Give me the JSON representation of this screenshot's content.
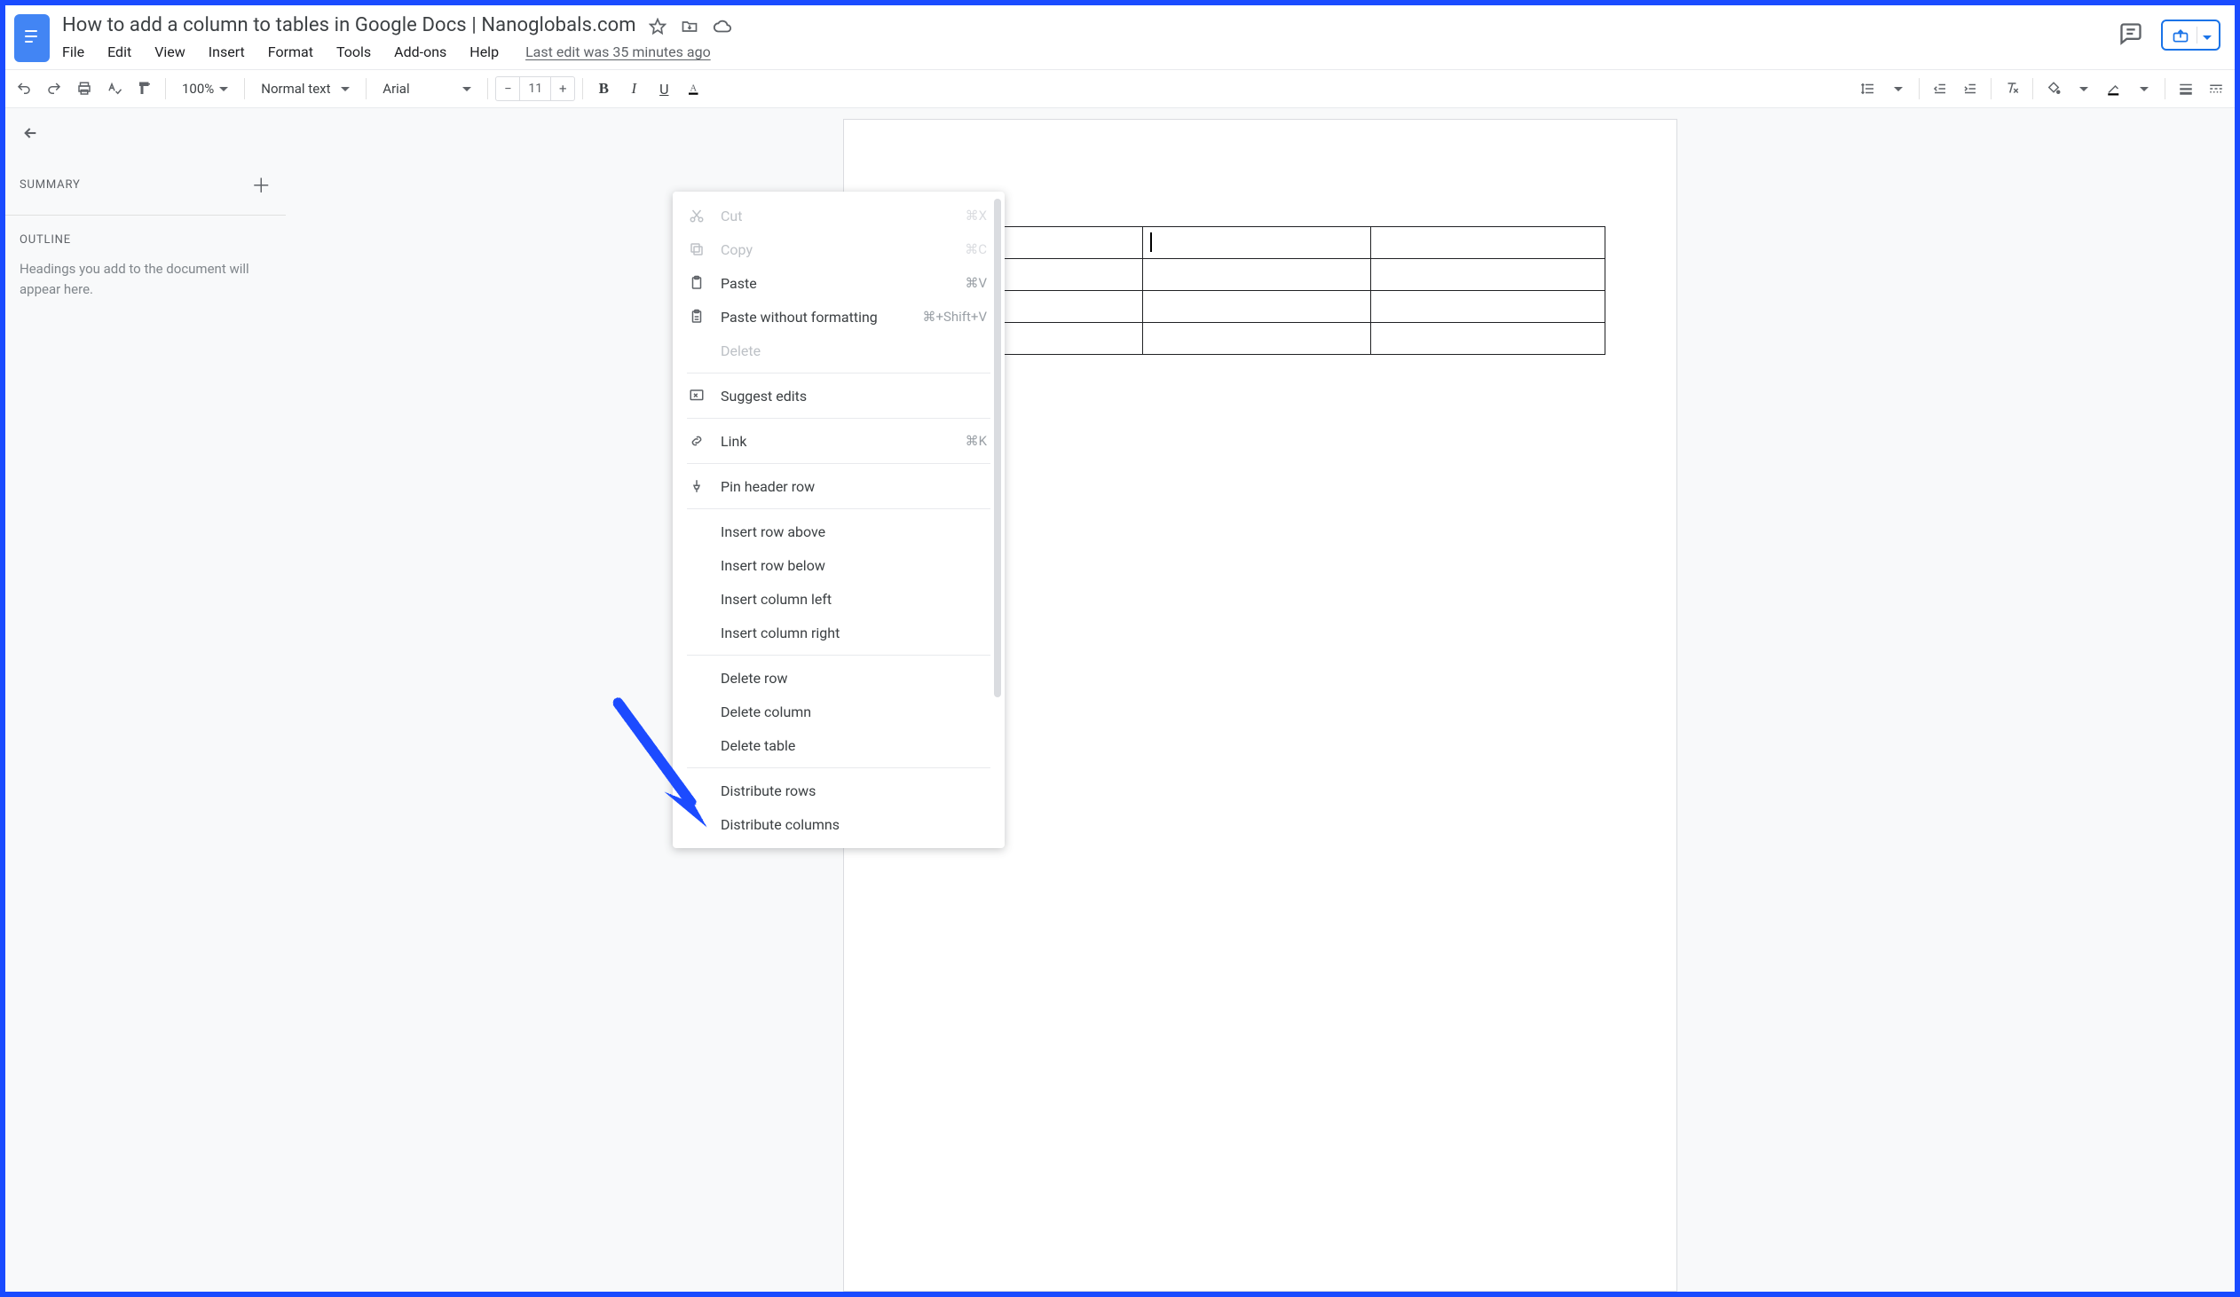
{
  "doc": {
    "title": "How to add a column to tables in Google Docs | Nanoglobals.com",
    "last_edit": "Last edit was 35 minutes ago"
  },
  "menus": {
    "file": "File",
    "edit": "Edit",
    "view": "View",
    "insert": "Insert",
    "format": "Format",
    "tools": "Tools",
    "addons": "Add-ons",
    "help": "Help"
  },
  "toolbar": {
    "zoom": "100%",
    "style": "Normal text",
    "font": "Arial",
    "font_size": "11"
  },
  "outline": {
    "summary_label": "SUMMARY",
    "outline_label": "OUTLINE",
    "empty": "Headings you add to the document will appear here."
  },
  "context_menu": {
    "cut": {
      "label": "Cut",
      "shortcut": "⌘X"
    },
    "copy": {
      "label": "Copy",
      "shortcut": "⌘C"
    },
    "paste": {
      "label": "Paste",
      "shortcut": "⌘V"
    },
    "paste_plain": {
      "label": "Paste without formatting",
      "shortcut": "⌘+Shift+V"
    },
    "delete": {
      "label": "Delete"
    },
    "suggest": {
      "label": "Suggest edits"
    },
    "link": {
      "label": "Link",
      "shortcut": "⌘K"
    },
    "pin": {
      "label": "Pin header row"
    },
    "row_above": {
      "label": "Insert row above"
    },
    "row_below": {
      "label": "Insert row below"
    },
    "col_left": {
      "label": "Insert column left"
    },
    "col_right": {
      "label": "Insert column right"
    },
    "del_row": {
      "label": "Delete row"
    },
    "del_col": {
      "label": "Delete column"
    },
    "del_table": {
      "label": "Delete table"
    },
    "dist_rows": {
      "label": "Distribute rows"
    },
    "dist_cols": {
      "label": "Distribute columns"
    }
  }
}
